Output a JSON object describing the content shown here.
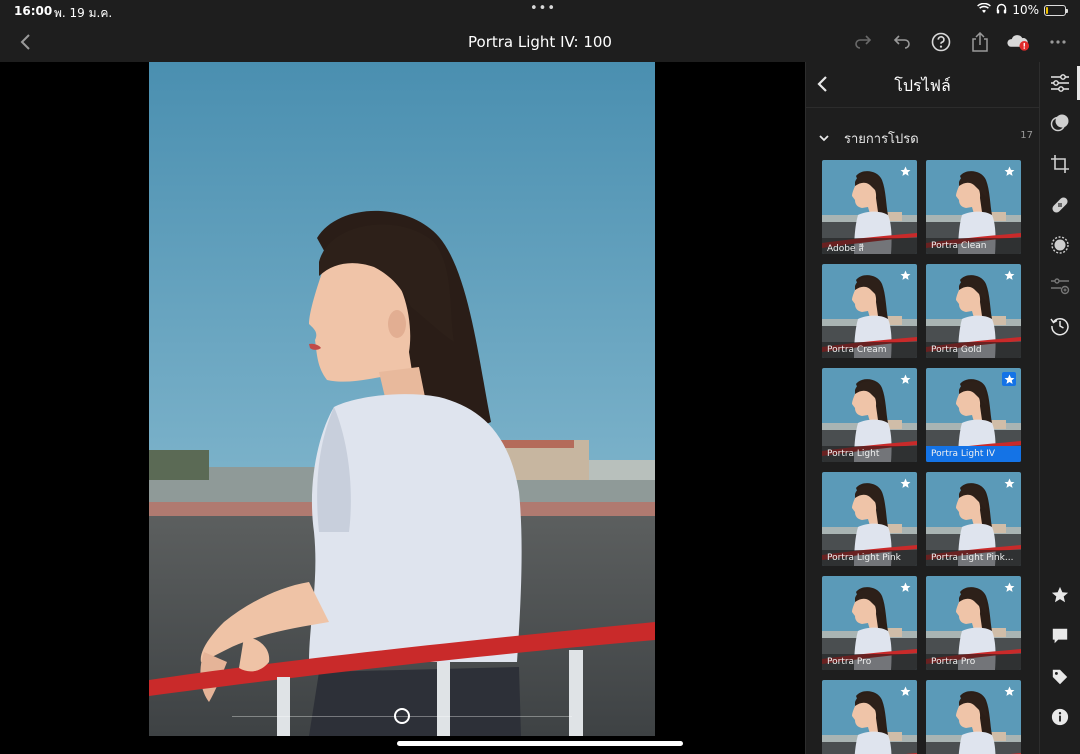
{
  "status_bar": {
    "time": "16:00",
    "date": "พ. 19 ม.ค.",
    "battery": "10%",
    "battery_level": 0.1
  },
  "nav": {
    "title": "Portra Light IV: 100"
  },
  "panel": {
    "title": "โปรไฟล์",
    "section_label": "รายการโปรด",
    "section_count": "17",
    "profiles": [
      {
        "label": "Adobe สี",
        "selected": false
      },
      {
        "label": "Portra Clean",
        "selected": false
      },
      {
        "label": "Portra Cream",
        "selected": false
      },
      {
        "label": "Portra Gold",
        "selected": false
      },
      {
        "label": "Portra Light",
        "selected": false
      },
      {
        "label": "Portra Light IV",
        "selected": true
      },
      {
        "label": "Portra Light Pink",
        "selected": false
      },
      {
        "label": "Portra Light Pink...",
        "selected": false
      },
      {
        "label": "Portra Pro",
        "selected": false
      },
      {
        "label": "Portra Pro",
        "selected": false
      },
      {
        "label": "",
        "selected": false
      },
      {
        "label": "",
        "selected": false
      }
    ]
  },
  "colors": {
    "accent": "#1473e6",
    "panel_bg": "#1e1e1e",
    "sky": "#4f95b4"
  }
}
